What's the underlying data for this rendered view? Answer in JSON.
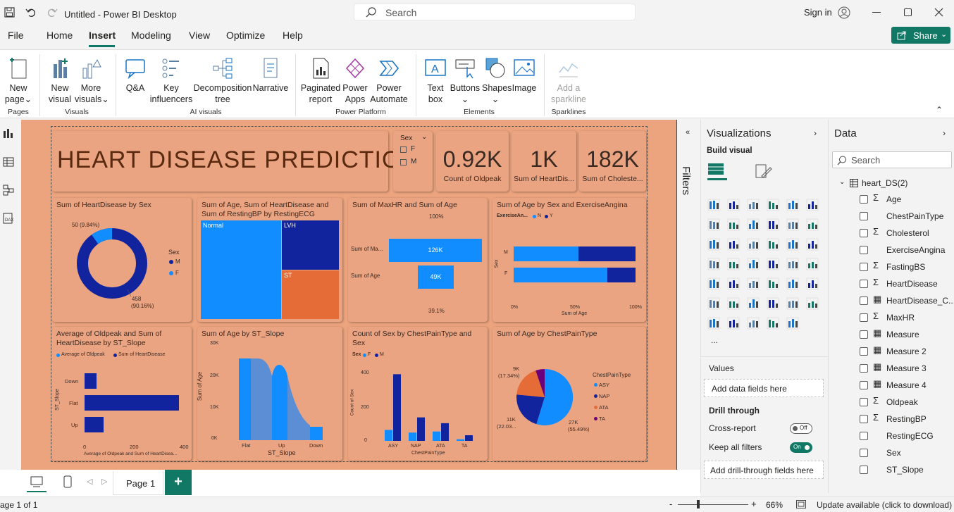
{
  "titlebar": {
    "title": "Untitled - Power BI Desktop",
    "search_placeholder": "Search",
    "sign_in": "Sign in"
  },
  "menu": {
    "file": "File",
    "home": "Home",
    "insert": "Insert",
    "modeling": "Modeling",
    "view": "View",
    "optimize": "Optimize",
    "help": "Help",
    "share": "Share"
  },
  "ribbon": {
    "new_page": "New page",
    "new_page_1": "New",
    "new_page_2": "page",
    "new_visual_1": "New",
    "new_visual_2": "visual",
    "more_visuals_1": "More",
    "more_visuals_2": "visuals",
    "qa": "Q&A",
    "key_infl_1": "Key",
    "key_infl_2": "influencers",
    "decomp_1": "Decomposition",
    "decomp_2": "tree",
    "narrative": "Narrative",
    "paginated_1": "Paginated",
    "paginated_2": "report",
    "powerapps_1": "Power",
    "powerapps_2": "Apps",
    "automate_1": "Power",
    "automate_2": "Automate",
    "textbox_1": "Text",
    "textbox_2": "box",
    "buttons": "Buttons",
    "shapes": "Shapes",
    "image": "Image",
    "sparkline_1": "Add a",
    "sparkline_2": "sparkline",
    "grp_pages": "Pages",
    "grp_visuals": "Visuals",
    "grp_ai": "AI visuals",
    "grp_platform": "Power Platform",
    "grp_elements": "Elements",
    "grp_sparklines": "Sparklines"
  },
  "report": {
    "title": "HEART DISEASE PREDICTION",
    "slicer": {
      "label": "Sex",
      "options": [
        "F",
        "M"
      ]
    },
    "kpis": [
      {
        "value": "0.92K",
        "label": "Count of Oldpeak"
      },
      {
        "value": "1K",
        "label": "Sum of HeartDis..."
      },
      {
        "value": "182K",
        "label": "Sum of Choleste..."
      }
    ],
    "donut": {
      "title": "Sum of HeartDisease by Sex",
      "legend_title": "Sex",
      "legend": [
        "M",
        "F"
      ],
      "label_f": "50 (9.84%)",
      "label_m_1": "458",
      "label_m_2": "(90.16%)",
      "values": {
        "M": 458,
        "F": 50
      }
    },
    "treemap": {
      "title_1": "Sum of Age, Sum of HeartDisease and",
      "title_2": "Sum of RestingBP by RestingECG",
      "labels": [
        "Normal",
        "LVH",
        "ST"
      ]
    },
    "funnel": {
      "title": "Sum of MaxHR and Sum of Age",
      "top_pct": "100%",
      "bottom_pct": "39.1%",
      "rows": [
        {
          "name": "Sum of Ma...",
          "value": "126K"
        },
        {
          "name": "Sum of Age",
          "value": "49K"
        }
      ]
    },
    "stacked": {
      "title": "Sum of Age by Sex and ExerciseAngina",
      "legend_title": "ExerciseAn...",
      "legend": [
        "N",
        "Y"
      ],
      "axis_y": "Sex",
      "rows": [
        "M",
        "F"
      ],
      "ticks": [
        "0%",
        "50%",
        "100%"
      ],
      "xlabel": "Sum of Age",
      "values": {
        "M": [
          0.53,
          0.47
        ],
        "F": [
          0.77,
          0.23
        ]
      }
    },
    "hbar": {
      "title_1": "Average of Oldpeak and Sum of",
      "title_2": "HeartDisease by ST_Slope",
      "legend": [
        "Average of Oldpeak",
        "Sum of HeartDisease"
      ],
      "axis_y": "ST_Slope",
      "categories": [
        "Down",
        "Flat",
        "Up"
      ],
      "ticks": [
        "0",
        "200",
        "400"
      ],
      "xlabel": "Average of Oldpeak and Sum of HeartDisea...",
      "values": [
        28,
        385,
        85
      ]
    },
    "area": {
      "title": "Sum of Age by ST_Slope",
      "ylabel": "Sum of Age",
      "ticks_y": [
        "30K",
        "20K",
        "10K",
        "0K"
      ],
      "categories": [
        "Flat",
        "Up",
        "Down"
      ],
      "xlabel": "ST_Slope"
    },
    "colchart": {
      "title_1": "Count of Sex by ChestPainType and",
      "title_2": "Sex",
      "legend_title": "Sex",
      "legend": [
        "F",
        "M"
      ],
      "ylabel": "Count of Sex",
      "ticks_y": [
        "400",
        "200",
        "0"
      ],
      "categories": [
        "ASY",
        "NAP",
        "ATA",
        "TA"
      ],
      "xlabel": "ChestPainType",
      "F": [
        70,
        53,
        60,
        10
      ],
      "M": [
        426,
        150,
        113,
        36
      ]
    },
    "pie": {
      "title": "Sum of Age by ChestPainType",
      "legend_title": "ChestPainType",
      "legend": [
        "ASY",
        "NAP",
        "ATA",
        "TA"
      ],
      "lbl_a": "9K",
      "lbl_a2": "(17.34%)",
      "lbl_b": "11K",
      "lbl_b2": "(22.03...",
      "lbl_c": "27K",
      "lbl_c2": "(55.49%)"
    }
  },
  "filters": {
    "label": "Filters"
  },
  "viz": {
    "title": "Visualizations",
    "build": "Build visual",
    "values": "Values",
    "add_fields": "Add data fields here",
    "drill": "Drill through",
    "cross": "Cross-report",
    "cross_state": "Off",
    "keep": "Keep all filters",
    "keep_state": "On",
    "add_drill": "Add drill-through fields here",
    "more": "..."
  },
  "data": {
    "title": "Data",
    "search": "Search",
    "table": "heart_DS(2)",
    "fields": [
      {
        "name": "Age",
        "sigma": "Σ"
      },
      {
        "name": "ChestPainType",
        "sigma": ""
      },
      {
        "name": "Cholesterol",
        "sigma": "Σ"
      },
      {
        "name": "ExerciseAngina",
        "sigma": ""
      },
      {
        "name": "FastingBS",
        "sigma": "Σ"
      },
      {
        "name": "HeartDisease",
        "sigma": "Σ"
      },
      {
        "name": "HeartDisease_C...",
        "sigma": "▦"
      },
      {
        "name": "MaxHR",
        "sigma": "Σ"
      },
      {
        "name": "Measure",
        "sigma": "▦"
      },
      {
        "name": "Measure 2",
        "sigma": "▦"
      },
      {
        "name": "Measure 3",
        "sigma": "▦"
      },
      {
        "name": "Measure 4",
        "sigma": "▦"
      },
      {
        "name": "Oldpeak",
        "sigma": "Σ"
      },
      {
        "name": "RestingBP",
        "sigma": "Σ"
      },
      {
        "name": "RestingECG",
        "sigma": ""
      },
      {
        "name": "Sex",
        "sigma": ""
      },
      {
        "name": "ST_Slope",
        "sigma": ""
      }
    ]
  },
  "pages": {
    "tab": "Page 1",
    "add": "+"
  },
  "status": {
    "page": "age 1 of 1",
    "zoom": "66%",
    "update": "Update available (click to download)",
    "minus": "-",
    "plus": "+"
  },
  "colors": {
    "canvas": "#eca47e",
    "dark": "#12239e",
    "light": "#118dff",
    "orange": "#e66c37",
    "purple": "#6b007b",
    "share": "#117865"
  }
}
